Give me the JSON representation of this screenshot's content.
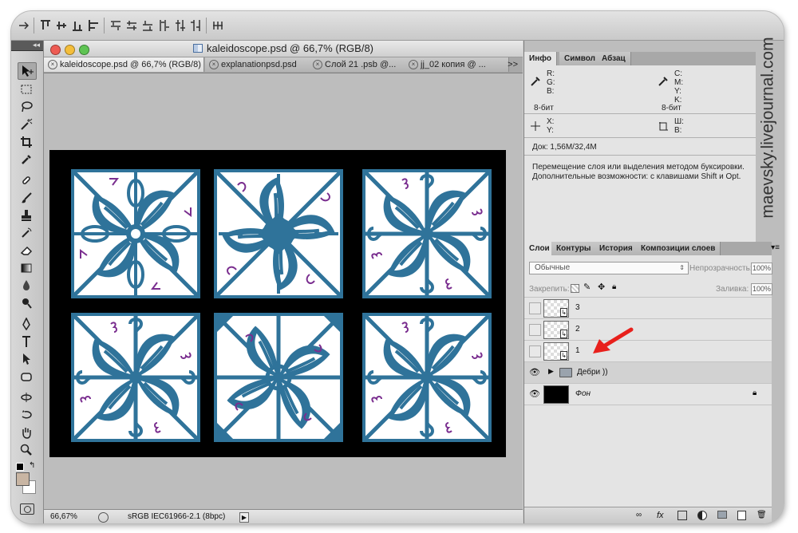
{
  "document": {
    "window_title": "kaleidoscope.psd @ 66,7% (RGB/8)",
    "tabs": [
      {
        "label": "kaleidoscope.psd @ 66,7% (RGB/8)",
        "active": true
      },
      {
        "label": "explanationpsd.psd",
        "active": false
      },
      {
        "label": "Слой 21 .psb @...",
        "active": false
      },
      {
        "label": "jj_02 копия @ ...",
        "active": false
      }
    ],
    "tabs_more": ">>",
    "status": {
      "zoom": "66,67%",
      "profile": "sRGB IEC61966-2.1 (8bpc)",
      "play": "▶"
    }
  },
  "info_panel": {
    "tabs": [
      "Инфо",
      "Символ",
      "Абзац"
    ],
    "rgb": [
      "R:",
      "G:",
      "B:"
    ],
    "cmyk": [
      "C:",
      "M:",
      "Y:",
      "K:"
    ],
    "bits_left": "8-бит",
    "bits_right": "8-бит",
    "xy": [
      "X:",
      "Y:"
    ],
    "wh": [
      "Ш:",
      "В:"
    ],
    "doc": "Док: 1,56M/32,4M",
    "hint_line1": "Перемещение слоя или выделения методом буксировки.",
    "hint_line2": "Дополнительные возможности: с клавишами Shift и Opt."
  },
  "layers_panel": {
    "tabs": [
      "Слои",
      "Контуры",
      "История",
      "Композиции слоев"
    ],
    "blend_mode": "Обычные",
    "opacity_label": "Непрозрачность:",
    "opacity_value": "100%",
    "lock_label": "Закрепить:",
    "fill_label": "Заливка:",
    "fill_value": "100%",
    "layers": [
      {
        "name": "3",
        "type": "smart",
        "visible": false
      },
      {
        "name": "2",
        "type": "smart",
        "visible": false
      },
      {
        "name": "1",
        "type": "smart",
        "visible": false
      },
      {
        "name": "Дебри ))",
        "type": "group",
        "visible": true
      },
      {
        "name": "Фон",
        "type": "background",
        "visible": true
      }
    ]
  },
  "watermark": "maevsky.livejournal.com",
  "colors": {
    "tile_blue": "#2f739a",
    "tile_purple": "#7a2e8f",
    "arrow_red": "#e8201c",
    "fg_swatch": "#c8b5a3"
  }
}
